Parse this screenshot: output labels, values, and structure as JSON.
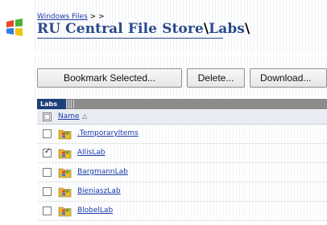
{
  "breadcrumb": {
    "link_label": "Windows Files",
    "separator": "> >"
  },
  "title": {
    "root": "RU Central File Store",
    "separator": "\\",
    "folder": "Labs",
    "trailing": "\\"
  },
  "toolbar": {
    "bookmark_label": "Bookmark Selected...",
    "delete_label": "Delete...",
    "download_label": "Download..."
  },
  "panel": {
    "tab_label": "Labs"
  },
  "table": {
    "column_name": "Name",
    "sort_glyph": "ⱏ",
    "rows": [
      {
        "name": ".TemporaryItems",
        "checked": false
      },
      {
        "name": "AllisLab",
        "checked": true
      },
      {
        "name": "BargmannLab",
        "checked": false
      },
      {
        "name": "BieniaszLab",
        "checked": false
      },
      {
        "name": "BlobelLab",
        "checked": false
      }
    ]
  },
  "colors": {
    "link": "#1a3aa6",
    "title": "#2b4a8a",
    "tab": "#1f3f7a",
    "bar": "#8c8c8c"
  }
}
